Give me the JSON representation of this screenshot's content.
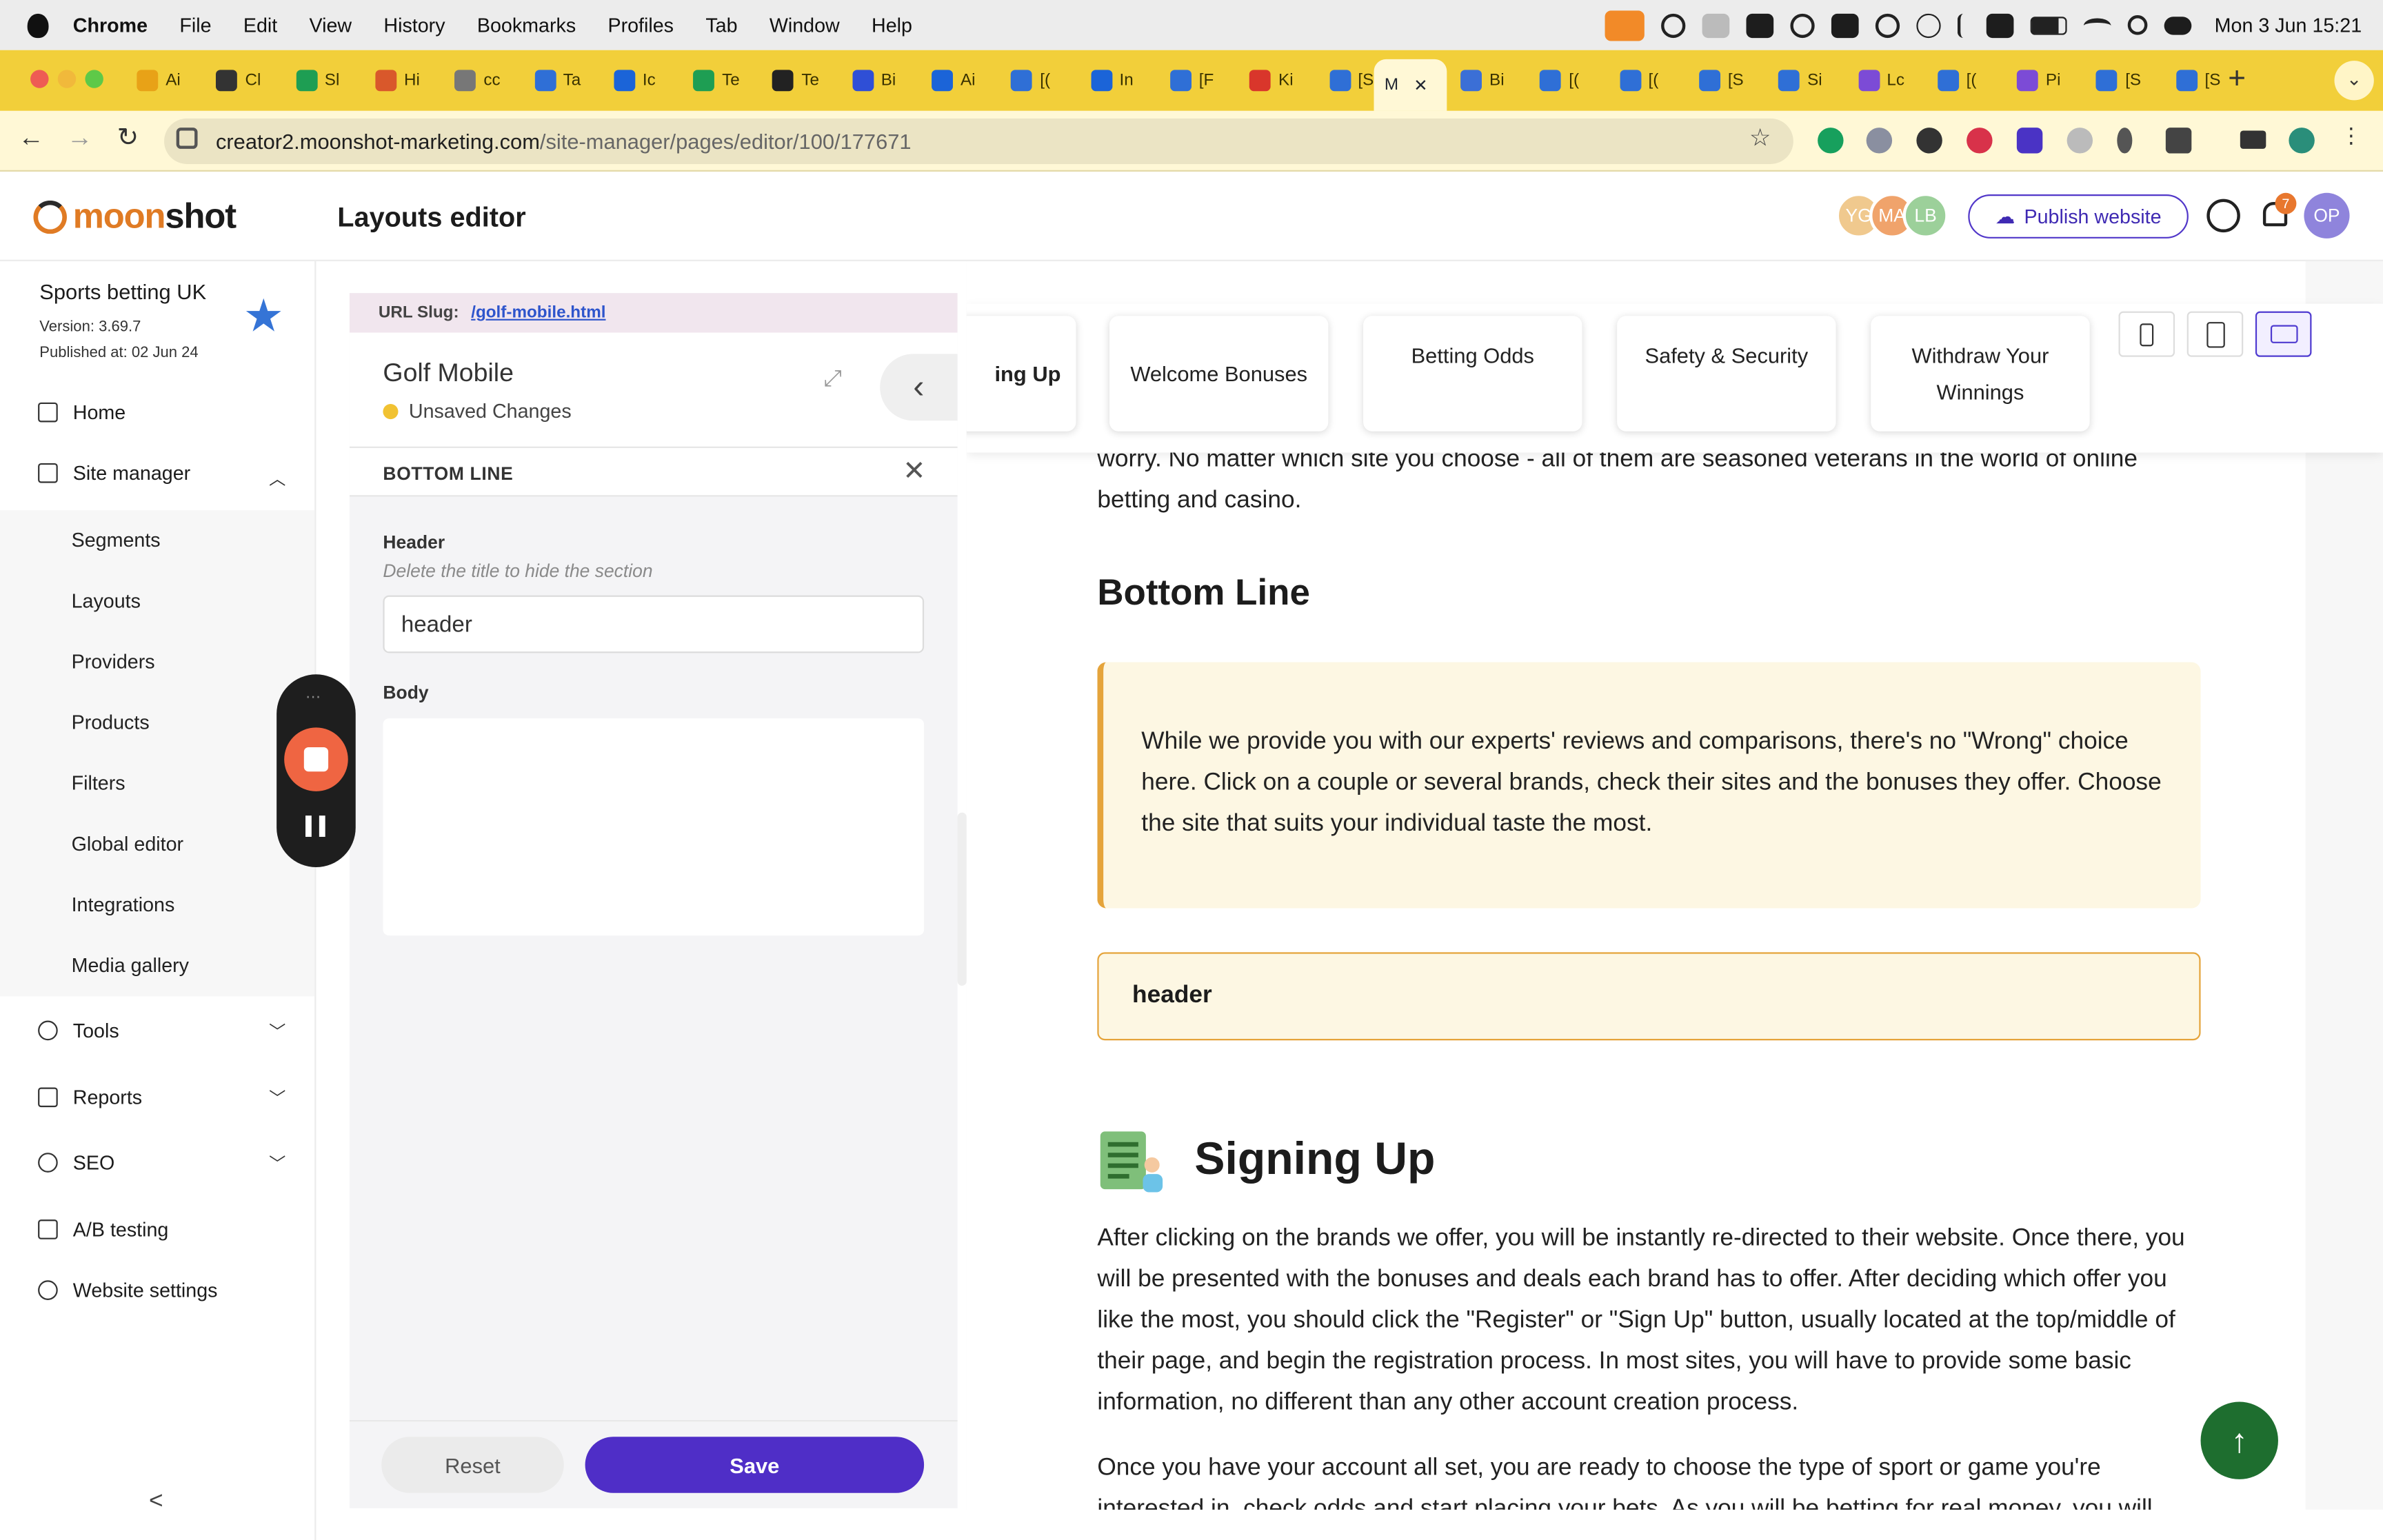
{
  "menubar": {
    "app": "Chrome",
    "items": [
      "File",
      "Edit",
      "View",
      "History",
      "Bookmarks",
      "Profiles",
      "Tab",
      "Window",
      "Help"
    ],
    "clock": "Mon 3 Jun  15:21"
  },
  "tabs": [
    {
      "label": "Ai",
      "color": "#e8a217"
    },
    {
      "label": "Cl",
      "color": "#333333"
    },
    {
      "label": "Sl",
      "color": "#1e9e53"
    },
    {
      "label": "Hi",
      "color": "#d9582b"
    },
    {
      "label": "cc",
      "color": "#777777"
    },
    {
      "label": "Ta",
      "color": "#2f6fd6"
    },
    {
      "label": "Ic",
      "color": "#1b64d8"
    },
    {
      "label": "Te",
      "color": "#1e9e53"
    },
    {
      "label": "Te",
      "color": "#222222"
    },
    {
      "label": "Bi",
      "color": "#2f4fd6"
    },
    {
      "label": "Ai",
      "color": "#1b64d8"
    },
    {
      "label": "[(",
      "color": "#2f6fd6"
    },
    {
      "label": "In",
      "color": "#1b64d8"
    },
    {
      "label": "[F",
      "color": "#2f6fd6"
    },
    {
      "label": "Ki",
      "color": "#d9362b"
    },
    {
      "label": "[S",
      "color": "#2f6fd6"
    }
  ],
  "active_tab": {
    "label": "M"
  },
  "tabs_right": [
    {
      "label": "Bi",
      "color": "#3b6fd6"
    },
    {
      "label": "[(",
      "color": "#2f6fd6"
    },
    {
      "label": "[(",
      "color": "#2f6fd6"
    },
    {
      "label": "[S",
      "color": "#2f6fd6"
    },
    {
      "label": "Si",
      "color": "#2f6fd6"
    },
    {
      "label": "Lc",
      "color": "#7c4bd6"
    },
    {
      "label": "[(",
      "color": "#2f6fd6"
    },
    {
      "label": "Pi",
      "color": "#7c4bd6"
    },
    {
      "label": "[S",
      "color": "#2f6fd6"
    },
    {
      "label": "[S",
      "color": "#2f6fd6"
    }
  ],
  "address": {
    "host": "creator2.moonshot-marketing.com",
    "path": "/site-manager/pages/editor/100/177671"
  },
  "app": {
    "logo": "moonshot",
    "title": "Layouts editor",
    "avatars": [
      {
        "initials": "YG",
        "color": "#f0c98e"
      },
      {
        "initials": "MA",
        "color": "#f0a36b"
      },
      {
        "initials": "LB",
        "color": "#9cd09a"
      }
    ],
    "publish_label": "Publish website",
    "notif_count": "7",
    "user_initials": "OP"
  },
  "sidebar": {
    "site_name": "Sports betting UK",
    "version": "Version: 3.69.7",
    "published": "Published at: 02 Jun 24",
    "home": "Home",
    "site_manager": "Site manager",
    "sub_items": [
      "Segments",
      "Layouts",
      "Providers",
      "Products",
      "Filters",
      "Global editor",
      "Integrations",
      "Media gallery"
    ],
    "tools": "Tools",
    "reports": "Reports",
    "seo": "SEO",
    "ab_testing": "A/B testing",
    "website_settings": "Website settings"
  },
  "panel": {
    "slug_label": "URL Slug:",
    "slug_value": "/golf-mobile.html",
    "page_name": "Golf Mobile",
    "status": "Unsaved Changes",
    "section_title": "BOTTOM LINE",
    "header_label": "Header",
    "header_hint": "Delete the title to hide the section",
    "header_value": "header",
    "body_label": "Body",
    "body_value": "",
    "reset_label": "Reset",
    "save_label": "Save"
  },
  "preview": {
    "nav_cards": [
      "ing Up",
      "Welcome Bonuses",
      "Betting Odds",
      "Safety & Security",
      "Withdraw Your Winnings"
    ],
    "intro_text": "worry. No matter which site you choose - all of them are seasoned veterans in the world of online betting and casino.",
    "bottom_line_heading": "Bottom Line",
    "callout_text": "While we provide you with our experts' reviews and comparisons, there's no \"Wrong\" choice here. Click on a couple or several brands, check their sites and the bonuses they offer. Choose the site that suits your individual taste the most.",
    "header_box": "header",
    "signing_up_heading": "Signing Up",
    "para1": "After clicking on the brands we offer, you will be instantly re-directed to their website. Once there, you will be presented with the bonuses and deals each brand has to offer. After deciding which offer you like the most, you should click the \"Register\" or \"Sign Up\" button, usually located at the top/middle of their page, and begin the registration process. In most sites, you will have to provide some basic information, no different than any other account creation process.",
    "para2": "Once you have your account all set, you are ready to choose the type of sport or game you're interested in, check odds and start placing your bets. As you will be betting for real money, you will"
  }
}
